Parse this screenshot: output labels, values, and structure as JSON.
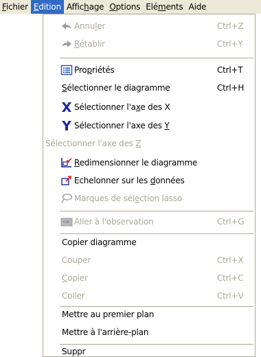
{
  "menubar": {
    "items": [
      {
        "pre": "",
        "ul": "F",
        "post": "ichier"
      },
      {
        "pre": "",
        "ul": "E",
        "post": "dition"
      },
      {
        "pre": "Affic",
        "ul": "h",
        "post": "age"
      },
      {
        "pre": "",
        "ul": "O",
        "post": "ptions"
      },
      {
        "pre": "Elé",
        "ul": "m",
        "post": "ents"
      },
      {
        "pre": "Aide",
        "ul": "",
        "post": ""
      }
    ]
  },
  "menu": {
    "undo": {
      "pre": "Annu",
      "ul": "l",
      "post": "er",
      "shortcut": "Ctrl+Z",
      "icon": "undo-arrow-icon"
    },
    "redo": {
      "pre": "",
      "ul": "R",
      "post": "établir",
      "shortcut": "Ctrl+Y",
      "icon": "redo-arrow-icon"
    },
    "properties": {
      "pre": "Pro",
      "ul": "p",
      "post": "riétés",
      "shortcut": "Ctrl+T",
      "icon": "properties-icon"
    },
    "select_diagram": {
      "pre": "",
      "ul": "S",
      "post": "électionner le diagramme",
      "shortcut": "Ctrl+H"
    },
    "select_x": {
      "pre": "Sélectionner l'a",
      "ul": "x",
      "post": "e des X",
      "icon": "x-axis-icon"
    },
    "select_y": {
      "pre": "Sélectionner l'axe des ",
      "ul": "Y",
      "post": "",
      "icon": "y-axis-icon"
    },
    "select_z": {
      "pre": "Sélectionner l'axe des ",
      "ul": "Z",
      "post": ""
    },
    "resize": {
      "pre": "",
      "ul": "R",
      "post": "edimensionner le diagramme",
      "icon": "resize-diagram-icon"
    },
    "scale": {
      "pre": "Echelonner sur les ",
      "ul": "d",
      "post": "onnées",
      "icon": "scale-data-icon"
    },
    "lasso": {
      "pre": "Marques de sél",
      "ul": "e",
      "post": "ction lasso",
      "icon": "lasso-icon"
    },
    "goto_obs": {
      "pre": "Aller à l'observation",
      "ul": "",
      "post": "",
      "shortcut": "Ctrl+G",
      "icon": "observation-icon"
    },
    "copy_diagram": {
      "pre": "Copier diagramme",
      "ul": "",
      "post": ""
    },
    "cut": {
      "pre": "Couper",
      "ul": "",
      "post": "",
      "shortcut": "Ctrl+X"
    },
    "copy": {
      "pre": "",
      "ul": "C",
      "post": "opier",
      "shortcut": "Ctrl+C"
    },
    "paste": {
      "pre": "Coller",
      "ul": "",
      "post": "",
      "shortcut": "Ctrl+V"
    },
    "bring_front": {
      "pre": "Mettre au premier plan",
      "ul": "",
      "post": ""
    },
    "send_back": {
      "pre": "Mettre à l'arrière-plan",
      "ul": "",
      "post": ""
    },
    "delete": {
      "pre": "Suppr",
      "ul": "",
      "post": ""
    }
  },
  "colors": {
    "menubar_bg": "#ece9d8",
    "highlight": "#316ac5",
    "disabled_text": "#aca899",
    "separator": "#aca899"
  }
}
